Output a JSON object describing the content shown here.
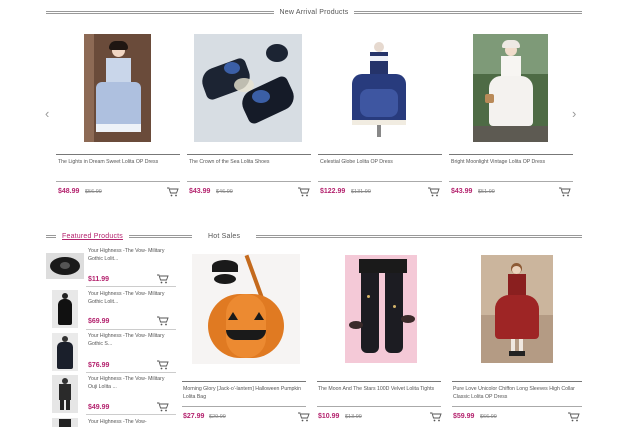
{
  "new_arrival": {
    "title": "New Arrival Products",
    "products": [
      {
        "name": "The Lights in Dream Sweet Lolita OP Dress",
        "price": "$48.99",
        "old_price": "$56.99",
        "image": "lolita-dress-light-blue"
      },
      {
        "name": "The Crown of the Sea Lolita Shoes",
        "price": "$43.99",
        "old_price": "$46.99",
        "image": "lolita-shoes-navy"
      },
      {
        "name": "Celestial Globe Lolita OP Dress",
        "price": "$122.99",
        "old_price": "$131.99",
        "image": "lolita-dress-navy-stars"
      },
      {
        "name": "Bright Moonlight Vintage Lolita OP Dress",
        "price": "$43.99",
        "old_price": "$51.99",
        "image": "lolita-dress-white"
      }
    ],
    "prev_icon": "chevron-left-icon",
    "next_icon": "chevron-right-icon"
  },
  "featured": {
    "title": "Featured Products",
    "items": [
      {
        "name": "Your Highness -The Vow- Military Gothic Lolit...",
        "price": "$11.99",
        "image": "black-accessory"
      },
      {
        "name": "Your Highness -The Vow- Military Gothic Lolit...",
        "price": "$69.99",
        "image": "black-gothic-dress"
      },
      {
        "name": "Your Highness -The Vow- Military Gothic S...",
        "price": "$76.99",
        "image": "black-gothic-coat"
      },
      {
        "name": "Your Highness -The Vow- Military Ouji Lolita ...",
        "price": "$49.99",
        "image": "black-ouji-outfit"
      },
      {
        "name": "Your Highness -The Vow-",
        "price": "",
        "image": "black-gothic-item"
      }
    ]
  },
  "hot_sales": {
    "title": "Hot Sales",
    "products": [
      {
        "name": "Morning Glory [Jack-o'-lantern] Halloween Pumpkin Lolita Bag",
        "price": "$27.99",
        "old_price": "$29.99",
        "image": "pumpkin-bag"
      },
      {
        "name": "The Moon And The Stars 100D Velvet Lolita Tights",
        "price": "$10.99",
        "old_price": "$13.99",
        "image": "black-tights"
      },
      {
        "name": "Pure Love Unicolor Chiffon Long Sleeves High Collar Classic Lolita OP Dress",
        "price": "$59.99",
        "old_price": "$66.99",
        "image": "red-classic-dress"
      }
    ]
  },
  "cart_icon": "shopping-cart-icon",
  "colors": {
    "accent": "#b4236e",
    "rule": "#999999"
  }
}
